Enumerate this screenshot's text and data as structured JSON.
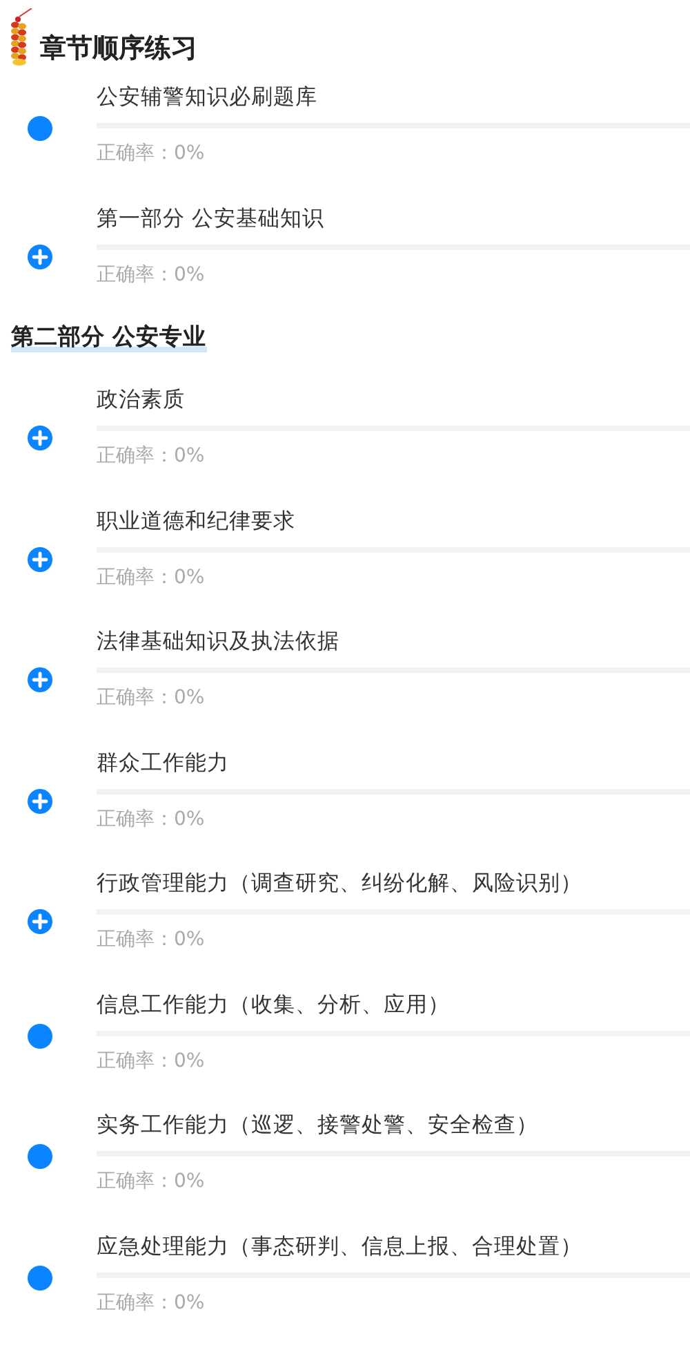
{
  "header": {
    "title": "章节顺序练习"
  },
  "groups": [
    {
      "items": [
        {
          "kind": "dot",
          "title": "公安辅警知识必刷题库",
          "level": 0,
          "accuracy": "正确率：0%"
        },
        {
          "kind": "plus",
          "title": "第一部分 公安基础知识",
          "level": 0,
          "accuracy": "正确率：0%"
        }
      ]
    },
    {
      "heading": "第二部分 公安专业",
      "items": [
        {
          "kind": "plus",
          "title": "政治素质",
          "level": 0,
          "accuracy": "正确率：0%"
        },
        {
          "kind": "plus",
          "title": "职业道德和纪律要求",
          "level": 0,
          "accuracy": "正确率：0%"
        },
        {
          "kind": "plus",
          "title": "法律基础知识及执法依据",
          "level": 0,
          "accuracy": "正确率：0%"
        },
        {
          "kind": "plus",
          "title": "群众工作能力",
          "level": 0,
          "accuracy": "正确率：0%"
        },
        {
          "kind": "plus",
          "title": "行政管理能力（调查研究、纠纷化解、风险识别）",
          "level": 0,
          "accuracy": "正确率：0%"
        },
        {
          "kind": "dot",
          "title": "信息工作能力（收集、分析、应用）",
          "level": 0,
          "accuracy": "正确率：0%"
        },
        {
          "kind": "dot",
          "title": "实务工作能力（巡逻、接警处警、安全检查）",
          "level": 0,
          "accuracy": "正确率：0%"
        },
        {
          "kind": "dot",
          "title": "应急处理能力（事态研判、信息上报、合理处置）",
          "level": 0,
          "accuracy": "正确率：0%"
        }
      ]
    }
  ]
}
